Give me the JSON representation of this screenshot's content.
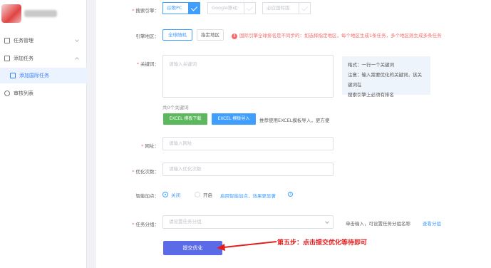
{
  "sidebar": {
    "items": [
      {
        "label": "任务管理",
        "icon": "file-icon"
      },
      {
        "label": "添加任务",
        "icon": "grid-icon"
      },
      {
        "label": "添加国际任务",
        "icon": "document-icon"
      },
      {
        "label": "审核列表",
        "icon": "eye-icon"
      }
    ]
  },
  "form": {
    "engine": {
      "label": "搜索引擎",
      "options": [
        {
          "label": "谷歌PC",
          "checked": true
        },
        {
          "label": "Google移动",
          "checked": false
        },
        {
          "label": "必应国际版",
          "checked": false
        }
      ]
    },
    "region": {
      "label": "引擎地区",
      "random_label": "全球随机",
      "specify_label": "指定地区",
      "warning": "国际引擎全球排名是不同步的：如选择指定地区，每个地区生成1条任务，多个地区则生成多条任务"
    },
    "keywords": {
      "label": "关键词",
      "placeholder": "请输入关键词",
      "count_text": "共0个关键词",
      "tips": [
        "格式：一行一个关键词",
        "注意：输入需要优化的关键词，该关键词在",
        "搜索引擎上必须有排名"
      ],
      "excel_download": "EXCEL 模板下载",
      "excel_import": "EXCEL 模板导入",
      "excel_hint": "推荐使用EXCEL模板导入，更方便"
    },
    "url": {
      "label": "网址",
      "placeholder": "请输入网址"
    },
    "times": {
      "label": "优化次数",
      "placeholder": "请输入优化次数"
    },
    "smart": {
      "label": "智能加点",
      "off_label": "关闭",
      "on_label": "开启",
      "selected": "关闭",
      "link": "启用智能加点，效果更显著"
    },
    "group": {
      "label": "任务分组",
      "placeholder": "请设置任务分组",
      "hint": "单击输入，可设置任务分组名称",
      "link": "查看分组"
    },
    "submit_label": "提交优化"
  },
  "annotation": "第五步：点击提交优化等待即可",
  "colors": {
    "accent": "#409eff",
    "excel_green": "#5cb85c",
    "danger": "#f56c6c",
    "submit": "#5b6be8"
  }
}
